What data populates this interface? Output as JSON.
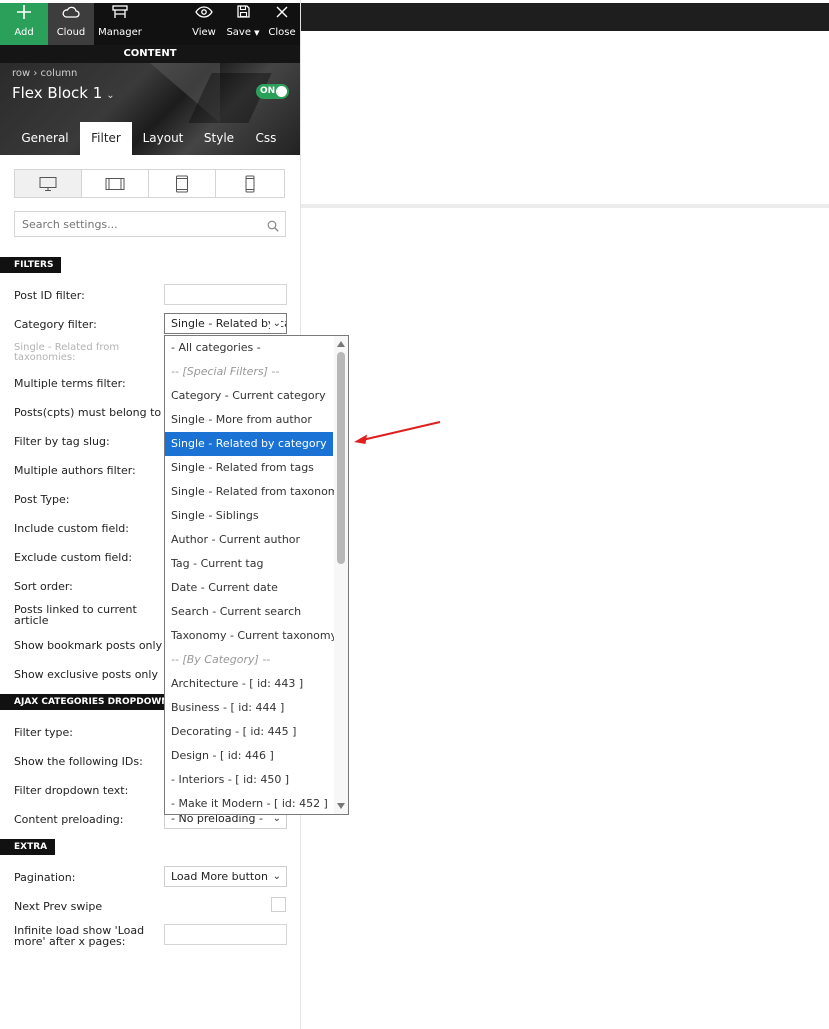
{
  "toolbar": {
    "add": "Add",
    "cloud": "Cloud",
    "manager": "Manager",
    "view": "View",
    "save": "Save",
    "close": "Close"
  },
  "content_bar": "CONTENT",
  "header": {
    "breadcrumb": "row › column",
    "title": "Flex Block 1",
    "toggle": "ON"
  },
  "tabs": [
    "General",
    "Filter",
    "Layout",
    "Style",
    "Css"
  ],
  "search": {
    "placeholder": "Search settings..."
  },
  "sections": {
    "filters": "FILTERS",
    "ajax": "AJAX CATEGORIES DROPDOWN",
    "extra": "EXTRA"
  },
  "labels": {
    "post_id": "Post ID filter:",
    "category": "Category filter:",
    "related_tax": "Single - Related from taxonomies:",
    "multiple_terms": "Multiple terms filter:",
    "must_belong": "Posts(cpts) must belong to all",
    "tag_slug": "Filter by tag slug:",
    "multiple_authors": "Multiple authors filter:",
    "post_type": "Post Type:",
    "include_custom": "Include custom field:",
    "exclude_custom": "Exclude custom field:",
    "sort_order": "Sort order:",
    "linked": "Posts linked to current article",
    "bookmark": "Show bookmark posts only",
    "exclusive": "Show exclusive posts only",
    "filter_type": "Filter type:",
    "show_ids": "Show the following IDs:",
    "dropdown_text": "Filter dropdown text:",
    "preloading": "Content preloading:",
    "pagination": "Pagination:",
    "swipe": "Next Prev swipe",
    "infinite": "Infinite load show 'Load more' after x pages:"
  },
  "values": {
    "category": "Single - Related by category",
    "preloading": "- No preloading -",
    "pagination": "Load More button"
  },
  "dropdown_options": [
    "- All categories -",
    "-- [Special Filters] --",
    "Category - Current category",
    "Single - More from author",
    "Single - Related by category",
    "Single - Related from tags",
    "Single - Related from taxonomy",
    "Single - Siblings",
    "Author - Current author",
    "Tag - Current tag",
    "Date - Current date",
    "Search - Current search",
    "Taxonomy - Current taxonomy",
    "-- [By Category] --",
    "Architecture - [ id: 443 ]",
    "Business - [ id: 444 ]",
    "Decorating - [ id: 445 ]",
    "Design - [ id: 446 ]",
    " - Interiors - [ id: 450 ]",
    " - Make it Modern - [ id: 452 ]"
  ],
  "selected_option_index": 4,
  "colors": {
    "accent_green": "#2aa05a",
    "selection_blue": "#1a73d4",
    "arrow_red": "#e02020"
  }
}
